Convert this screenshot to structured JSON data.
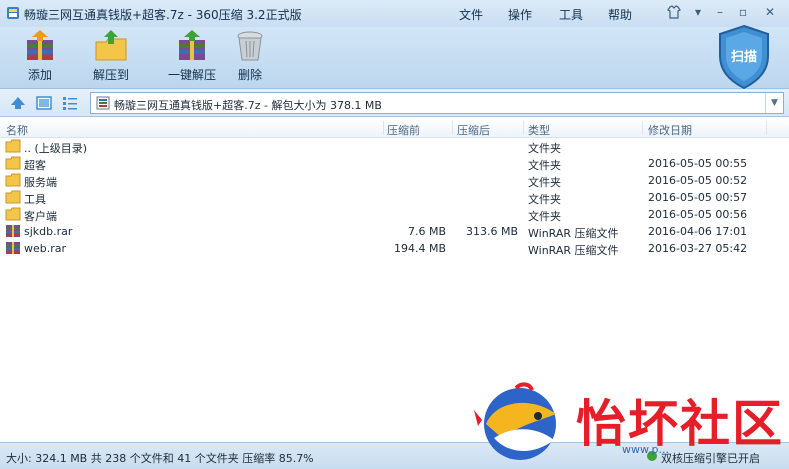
{
  "window": {
    "title": "畅璇三网互通真钱版+超客.7z - 360压缩 3.2正式版",
    "menu": [
      "文件",
      "操作",
      "工具",
      "帮助"
    ]
  },
  "toolbar": {
    "add": "添加",
    "extract_to": "解压到",
    "one_click_extract": "一键解压",
    "delete": "删除",
    "scan": "扫描"
  },
  "address": {
    "path": "畅璇三网互通真钱版+超客.7z - 解包大小为 378.1 MB"
  },
  "columns": {
    "name": "名称",
    "compressed": "压缩前",
    "uncompressed": "压缩后",
    "type": "类型",
    "modified": "修改日期"
  },
  "files": [
    {
      "name": ".. (上级目录)",
      "before": "",
      "after": "",
      "type": "文件夹",
      "date": "",
      "icon": "folder-icon"
    },
    {
      "name": "超客",
      "before": "",
      "after": "",
      "type": "文件夹",
      "date": "2016-05-05 00:55",
      "icon": "folder-icon"
    },
    {
      "name": "服务端",
      "before": "",
      "after": "",
      "type": "文件夹",
      "date": "2016-05-05 00:52",
      "icon": "folder-icon"
    },
    {
      "name": "工具",
      "before": "",
      "after": "",
      "type": "文件夹",
      "date": "2016-05-05 00:57",
      "icon": "folder-icon"
    },
    {
      "name": "客户端",
      "before": "",
      "after": "",
      "type": "文件夹",
      "date": "2016-05-05 00:56",
      "icon": "folder-icon"
    },
    {
      "name": "sjkdb.rar",
      "before": "7.6 MB",
      "after": "313.6 MB",
      "type": "WinRAR 压缩文件",
      "date": "2016-04-06 17:01",
      "icon": "rar-archive-icon"
    },
    {
      "name": "web.rar",
      "before": "194.4 MB",
      "after": "",
      "type": "WinRAR 压缩文件",
      "date": "2016-03-27 05:42",
      "icon": "rar-archive-icon"
    }
  ],
  "status": {
    "summary": "大小: 324.1 MB 共 238 个文件和 41 个文件夹 压缩率 85.7%",
    "right": "双核压缩引擎已开启"
  },
  "watermark": {
    "text": "怡坏社区",
    "url": "www.p..."
  },
  "colors": {
    "accent": "#3f8fd2",
    "watermark_red": "#e61e29"
  }
}
